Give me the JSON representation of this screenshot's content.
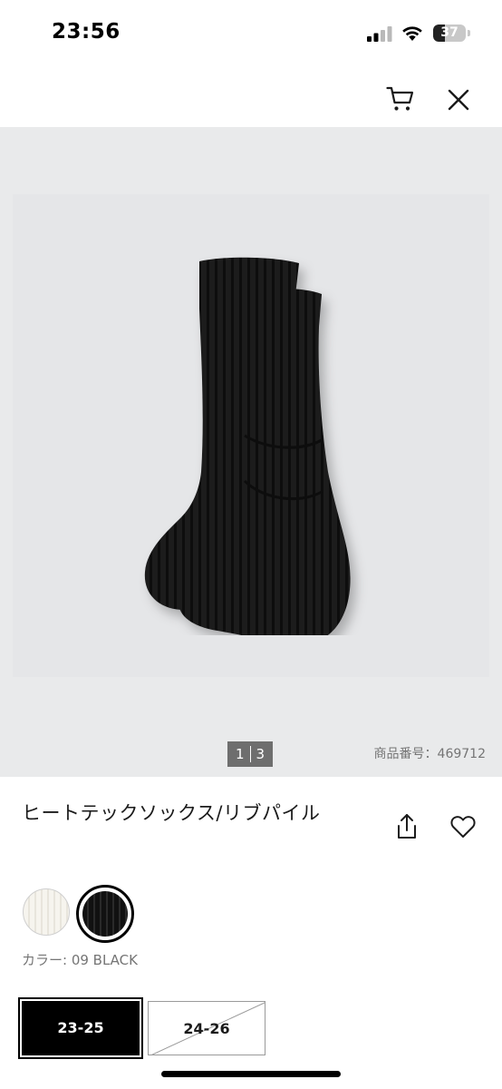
{
  "status_bar": {
    "time": "23:56",
    "battery_level": "37",
    "battery_fraction": 0.37,
    "icons": [
      "signal-icon",
      "wifi-icon",
      "battery-icon"
    ]
  },
  "header": {
    "icons": [
      "cart-icon",
      "close-icon"
    ]
  },
  "gallery": {
    "current_page": "1",
    "total_pages": "3",
    "product_number": "商品番号：469712",
    "background_color": "#e9eaeb"
  },
  "product": {
    "name": "ヒートテックソックス/リブパイル",
    "icons": [
      "share-icon",
      "heart-icon"
    ]
  },
  "colors": {
    "swatches": [
      "white",
      "black"
    ],
    "selected": "black",
    "label": "カラー: 09 BLACK"
  },
  "sizes": {
    "options": [
      {
        "label": "23-25",
        "state": "selected"
      },
      {
        "label": "24-26",
        "state": "unavailable"
      }
    ]
  }
}
